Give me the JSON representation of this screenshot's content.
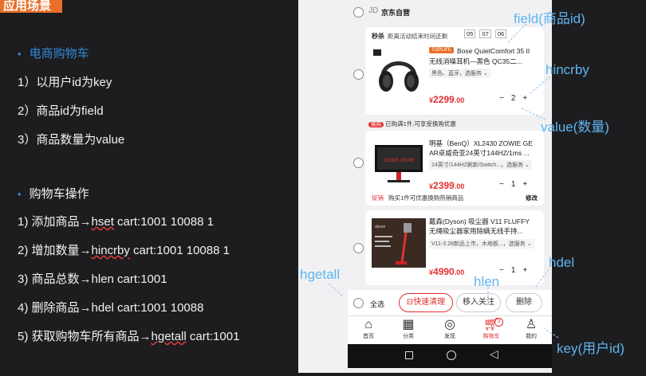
{
  "slide": {
    "section_title": "应用场景",
    "scenario_head": "电商购物车",
    "scenario_items": [
      "1）以用户id为key",
      "2）商品id为field",
      "3）商品数量为value"
    ],
    "ops_head": "购物车操作",
    "ops": [
      {
        "label": "1) 添加商品",
        "cmd_kw": "hset",
        "cmd_rest": " cart:1001 10088 1"
      },
      {
        "label": "2) 增加数量",
        "cmd_kw": "hincrby",
        "cmd_rest": " cart:1001 10088 1"
      },
      {
        "label": "3) 商品总数",
        "cmd_kw": "hlen",
        "cmd_rest": " cart:1001"
      },
      {
        "label": "4) 删除商品",
        "cmd_kw": "hdel",
        "cmd_rest": " cart:1001 10088"
      },
      {
        "label": "5) 获取购物车所有商品",
        "cmd_kw": "hgetall",
        "cmd_rest": " cart:1001"
      }
    ],
    "arrow": "→"
  },
  "annotations": {
    "field": "field(商品id)",
    "hincrby": "hincrby",
    "value": "value(数量)",
    "hgetall": "hgetall",
    "hdel": "hdel",
    "hlen": "hlen",
    "key": "key(用户id)"
  },
  "phone": {
    "store_icon": "JD",
    "store": "京东自营",
    "flash_label": "秒杀",
    "flash_text": "距离活动结束时间还剩",
    "countdown": [
      "05",
      "07",
      "06"
    ],
    "items": [
      {
        "badge": "TOPLIFE",
        "title1": "Bose QuietComfort 35 II",
        "title2": "无线消噪耳机—黑色 QC35二...",
        "option": "黑色、蓝牙，选服务",
        "price_sym": "¥",
        "price_int": "2299",
        "price_dec": ".00",
        "qty": "2"
      },
      {
        "title1": "明基（BenQ）XL2430 ZOWIE GE",
        "title2": "AR卓威奇亚24英寸144HZ/1ms ...",
        "option": "24英寸/144HZ刷新/Switch...，选服务",
        "price_sym": "¥",
        "price_int": "2399",
        "price_dec": ".00",
        "qty": "1"
      },
      {
        "title1": "戴森(Dyson) 吸尘器 V11 FLUFFY",
        "title2": "无绳吸尘器家用除螨无线手持...",
        "option": "V11-3.28新品上市，木地板...，选服务",
        "price_sym": "¥",
        "price_int": "4990",
        "price_dec": ".00",
        "qty": "1"
      }
    ],
    "promo1_tag": "换购",
    "promo1_text": "已购满1件,可享受换购优惠",
    "promo2_tag": "促销",
    "promo2_text": "购买1件可优惠换购热销商品",
    "promo2_action": "修改",
    "select_all": "全选",
    "clear_btn": "快速清理",
    "move_btn": "移入关注",
    "delete_btn": "删除",
    "cart_badge": "3",
    "nav": [
      "首页",
      "分类",
      "发现",
      "购物车",
      "我的"
    ],
    "sysnav": [
      "back",
      "home",
      "recent"
    ]
  },
  "colors": {
    "accent": "#e23030",
    "annotation": "#5fb4f0",
    "tag": "#e8702a",
    "bullet": "#2f8ad8"
  }
}
